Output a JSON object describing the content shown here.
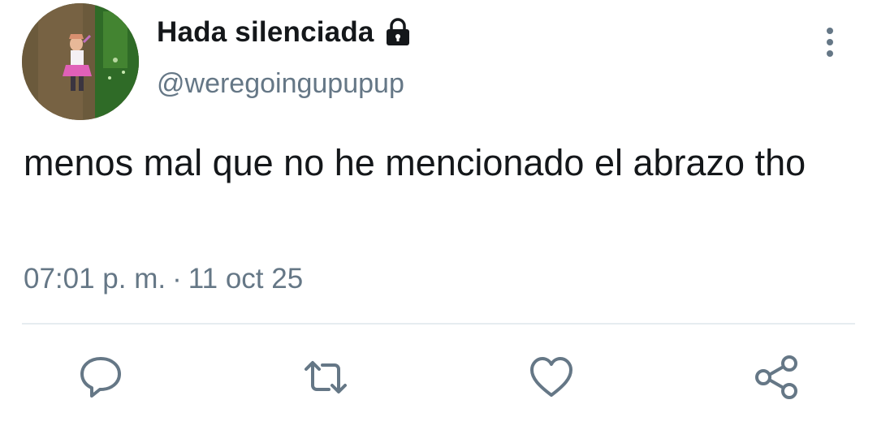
{
  "user": {
    "display_name": "Hada silenciada",
    "handle": "@weregoingupupup",
    "protected_icon": "lock-icon",
    "avatar_icon": "profile-avatar"
  },
  "tweet": {
    "text": "menos mal que no he mencionado el abrazo tho",
    "time": "07:01 p. m.",
    "separator": "·",
    "date": "11 oct 25"
  },
  "actions": [
    {
      "name": "reply",
      "icon": "speech-bubble-icon"
    },
    {
      "name": "retweet",
      "icon": "retweet-icon"
    },
    {
      "name": "like",
      "icon": "heart-icon"
    },
    {
      "name": "share",
      "icon": "share-icon"
    }
  ],
  "menu": {
    "icon": "vertical-dots-icon"
  },
  "colors": {
    "text": "#14171a",
    "muted": "#657786",
    "divider": "#e6ecf0",
    "icon": "#657786"
  }
}
